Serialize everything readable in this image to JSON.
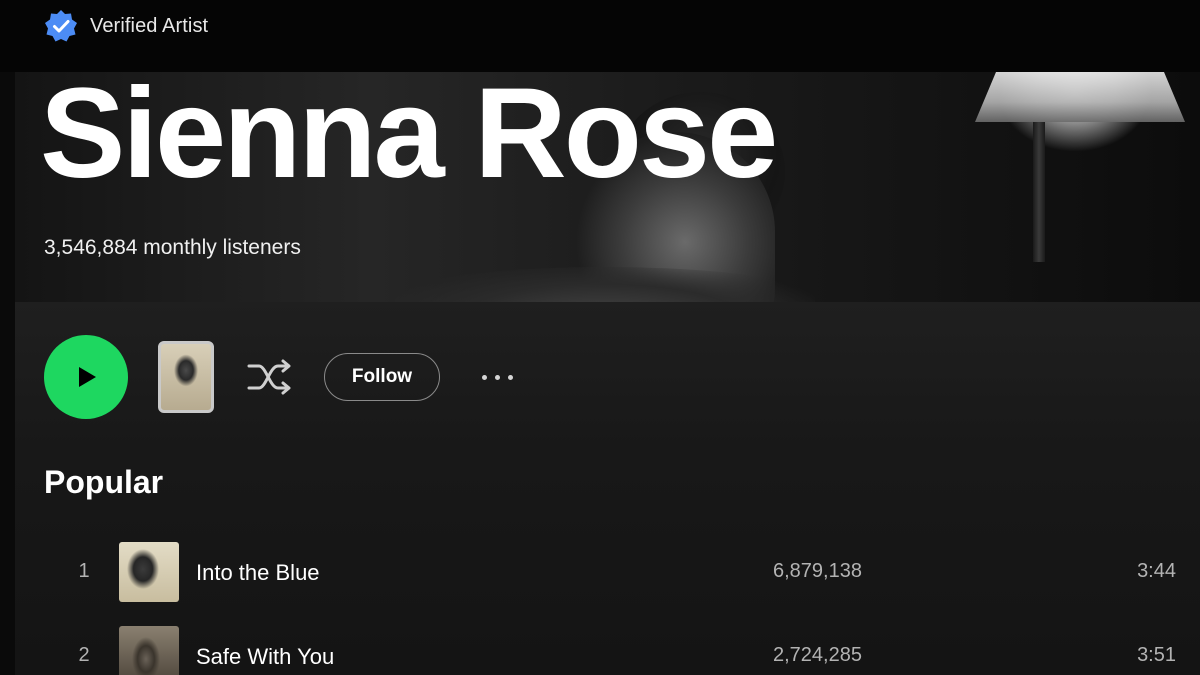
{
  "header": {
    "verified_label": "Verified Artist",
    "artist_name": "Sienna Rose",
    "monthly_listeners": "3,546,884 monthly listeners"
  },
  "actions": {
    "follow_label": "Follow"
  },
  "popular": {
    "title": "Popular",
    "tracks": [
      {
        "number": "1",
        "title": "Into the Blue",
        "plays": "6,879,138",
        "duration": "3:44"
      },
      {
        "number": "2",
        "title": "Safe With You",
        "plays": "2,724,285",
        "duration": "3:51"
      }
    ]
  },
  "colors": {
    "background": "#121212",
    "play_button": "#1ed760",
    "verified_badge": "#4c8cf5",
    "secondary_text": "#b3b3b3"
  },
  "icons": {
    "verified": "verified-badge-icon",
    "play": "play-icon",
    "shuffle": "shuffle-icon",
    "more": "more-options-icon"
  }
}
